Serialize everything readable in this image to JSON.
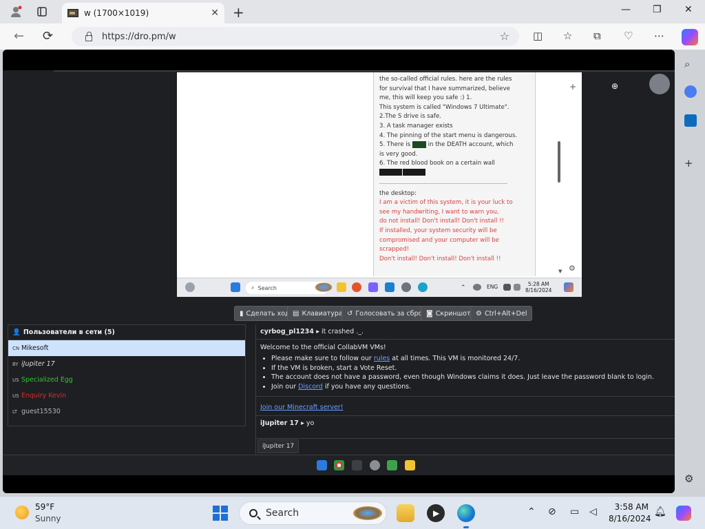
{
  "browser": {
    "tab_title": "w (1700×1019)",
    "url": "https://dro.pm/w"
  },
  "document": {
    "lines": [
      {
        "text": "the so-called official rules. here are the rules",
        "style": "normal"
      },
      {
        "text": "for survival that I have summarized, believe",
        "style": "normal"
      },
      {
        "text": "me, this will keep you safe :) 1.",
        "style": "normal"
      },
      {
        "text": "This system is called \"Windows 7 Ultimate\".",
        "style": "normal"
      },
      {
        "text": "2.The S drive is safe.",
        "style": "normal"
      },
      {
        "text": "3. A task manager exists",
        "style": "normal"
      },
      {
        "text": "4. The pinning of the start menu is dangerous.",
        "style": "normal"
      }
    ],
    "line5_pre": "5. There is",
    "line5_post": "in the DEATH account, which",
    "line5b": "is very good.",
    "line6": "6. The red blood book on a certain wall",
    "desktop_label": "the desktop:",
    "red_lines": [
      "I am a victim of this system, it is your luck to",
      "see my handwriting, I want to warn you,",
      "do not install! Don't install! Don't install !!",
      "If installed, your system security will be",
      "compromised and your computer will be",
      "scrapped!",
      "Don't install! Don't install! Don't install !!"
    ]
  },
  "vm_taskbar": {
    "search": "Search",
    "lang": "ENG",
    "time": "5:28 AM",
    "date": "8/16/2024"
  },
  "controls": {
    "take_turn": "Сделать ход",
    "keyboard": "Клавиатура",
    "vote_reset": "Голосовать за сброс",
    "screenshot": "Скриншот",
    "cad": "Ctrl+Alt+Del"
  },
  "users": {
    "header": "Пользователи в сети (5)",
    "list": [
      {
        "cc": "CN",
        "name": "Mikesoft",
        "color": "#111111",
        "italic": false
      },
      {
        "cc": "BY",
        "name": "iJupiter 17",
        "color": "#e6e6e6",
        "italic": true
      },
      {
        "cc": "US",
        "name": "Specialized Egg",
        "color": "#35c435",
        "italic": false
      },
      {
        "cc": "US",
        "name": "Enquiry Kevin",
        "color": "#d23030",
        "italic": false
      },
      {
        "cc": "LT",
        "name": "guest15530",
        "color": "#b5b5b5",
        "italic": false
      }
    ]
  },
  "chat": {
    "msg1_user": "cyrbog_pl1234 ▸",
    "msg1_text": "it crashed ._.",
    "welcome": "Welcome to the official CollabVM VMs!",
    "bullet1_pre": "Please make sure to follow our",
    "bullet1_link": "rules",
    "bullet1_post": "at all times. This VM is monitored 24/7.",
    "bullet2": "If the VM is broken, start a Vote Reset.",
    "bullet3": "The account does not have a password, even though Windows claims it does. Just leave the password blank to login.",
    "bullet4_pre": "Join our",
    "bullet4_link": "Discord",
    "bullet4_post": "if you have any questions.",
    "minecraft": "Join our Minecraft server!",
    "msg2_user": "iJupiter 17 ▸",
    "msg2_text": "yo",
    "typing_tag": "iJupiter 17"
  },
  "taskbar": {
    "temp": "59°F",
    "condition": "Sunny",
    "search": "Search",
    "time": "3:58 AM",
    "date": "8/16/2024"
  }
}
